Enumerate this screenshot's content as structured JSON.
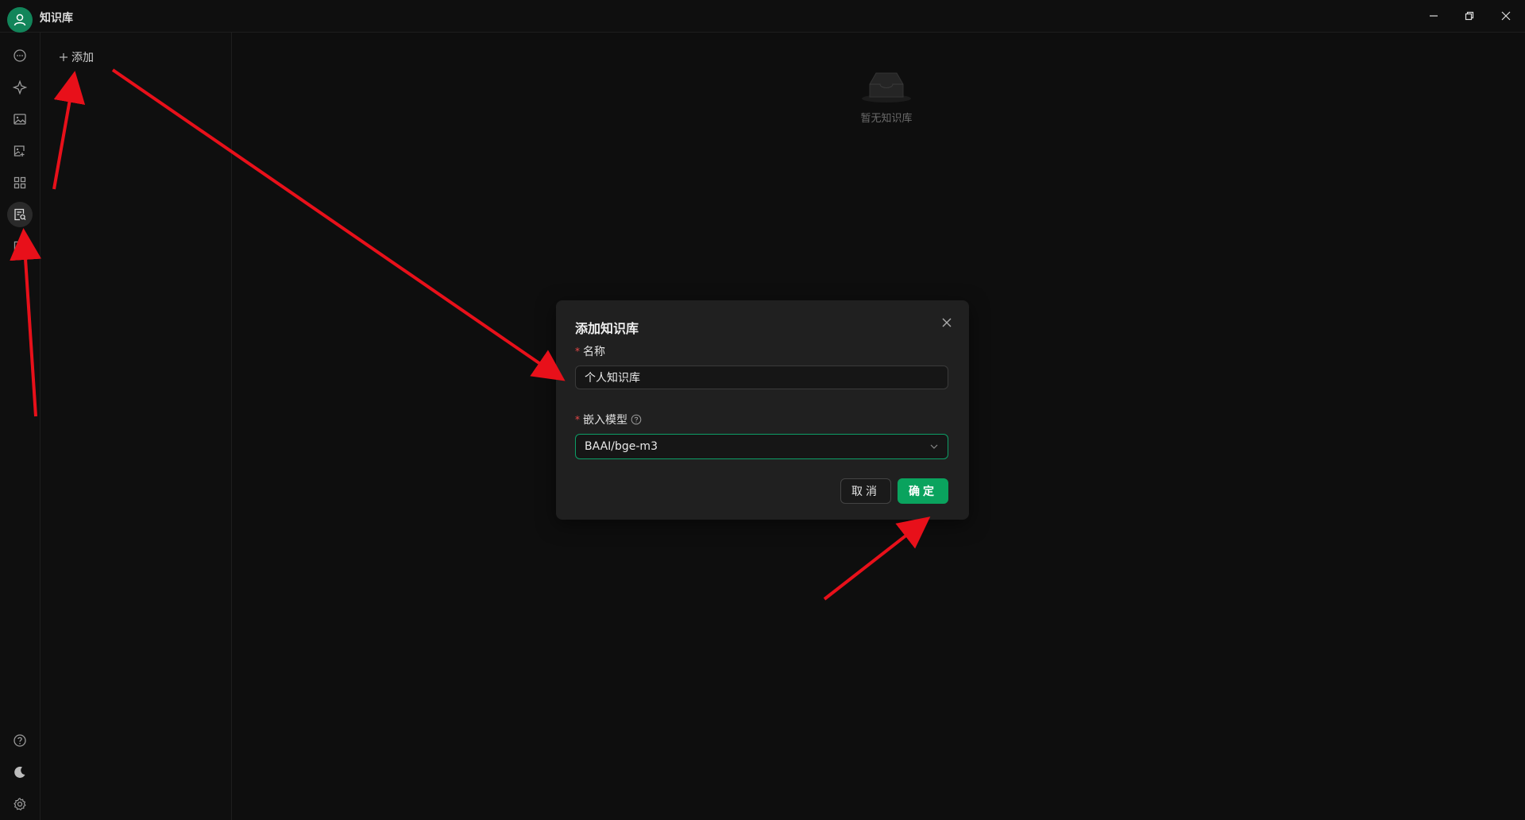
{
  "window": {
    "title": "知识库",
    "controls": [
      "minimize-icon",
      "restore-icon",
      "close-icon"
    ]
  },
  "sidebar": {
    "top_items": [
      {
        "name": "chat",
        "icon": "chat-bubble-icon"
      },
      {
        "name": "agents",
        "icon": "sparkle-icon"
      },
      {
        "name": "paintings",
        "icon": "image-icon"
      },
      {
        "name": "translate",
        "icon": "image-edit-icon"
      },
      {
        "name": "apps",
        "icon": "grid-icon"
      },
      {
        "name": "knowledge",
        "icon": "knowledge-search-icon",
        "active": true
      },
      {
        "name": "files",
        "icon": "folder-icon"
      }
    ],
    "bottom_items": [
      {
        "name": "help",
        "icon": "help-circle-icon"
      },
      {
        "name": "theme",
        "icon": "moon-icon"
      },
      {
        "name": "settings",
        "icon": "gear-icon"
      }
    ]
  },
  "list_panel": {
    "add_label": "添加"
  },
  "main": {
    "empty_text": "暂无知识库"
  },
  "modal": {
    "title": "添加知识库",
    "name_label": "名称",
    "name_value": "个人知识库",
    "model_label": "嵌入模型",
    "model_value": "BAAI/bge-m3",
    "cancel_label": "取消",
    "ok_label": "确定",
    "required_mark": "*"
  },
  "colors": {
    "accent": "#0aa35e",
    "background": "#0f0f0f",
    "modal_bg": "#202020",
    "annotation_arrow": "#e8101a"
  }
}
